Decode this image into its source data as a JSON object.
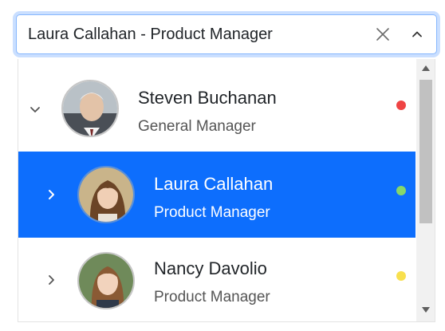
{
  "input": {
    "value": "Laura Callahan - Product Manager"
  },
  "icons": {
    "clear": "close-icon",
    "toggle": "chevron-up-icon"
  },
  "tree": {
    "items": [
      {
        "name": "Steven Buchanan",
        "role": "General Manager",
        "expanded": true,
        "selected": false,
        "status_color": "#ef4444",
        "avatar": "avatar-steven"
      },
      {
        "name": "Laura Callahan",
        "role": "Product Manager",
        "expanded": false,
        "selected": true,
        "status_color": "#86d76a",
        "avatar": "avatar-laura"
      },
      {
        "name": "Nancy Davolio",
        "role": "Product Manager",
        "expanded": false,
        "selected": false,
        "status_color": "#f8e04e",
        "avatar": "avatar-nancy"
      }
    ]
  },
  "colors": {
    "accent": "#0d6efd",
    "focus_border": "#86b7fe"
  }
}
